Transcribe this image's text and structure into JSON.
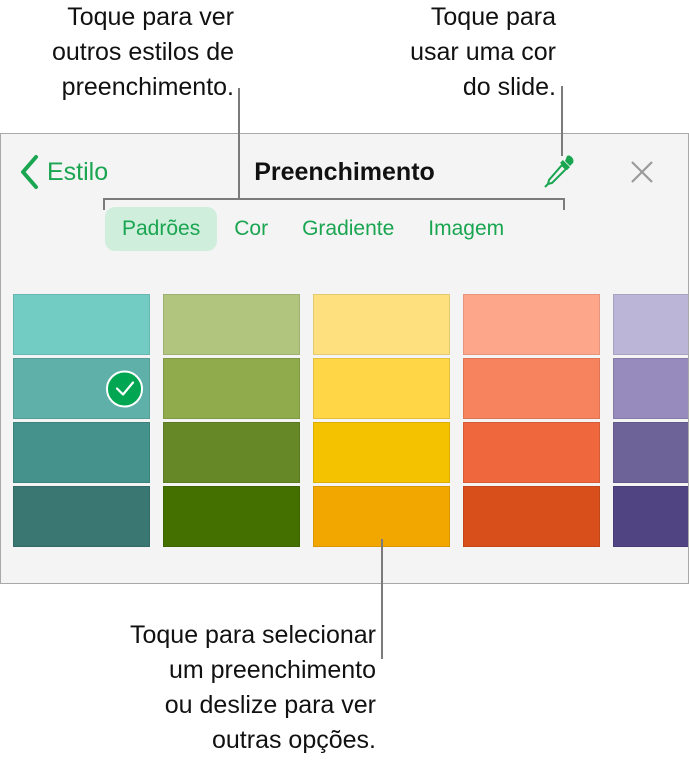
{
  "callouts": {
    "fill_styles": "Toque para ver\noutros estilos de\npreenchimento.",
    "slide_color": "Toque para\nusar uma cor\ndo slide.",
    "select_fill": "Toque para selecionar\num preenchimento\nou deslize para ver\noutras opções."
  },
  "panel": {
    "back_label": "Estilo",
    "title": "Preenchimento",
    "icons": {
      "back": "chevron-left-icon",
      "eyedropper": "eyedropper-icon",
      "close": "close-icon",
      "selected": "checkmark-icon"
    },
    "tabs": [
      {
        "label": "Padrões",
        "active": true
      },
      {
        "label": "Cor",
        "active": false
      },
      {
        "label": "Gradiente",
        "active": false
      },
      {
        "label": "Imagem",
        "active": false
      }
    ],
    "accent_color": "#1aa551",
    "swatch_columns": [
      {
        "name": "teal",
        "colors": [
          "#72ccc4",
          "#5eb0a9",
          "#45928c",
          "#3a7773"
        ]
      },
      {
        "name": "green",
        "colors": [
          "#b2c57e",
          "#8fab4b",
          "#678827",
          "#447000"
        ]
      },
      {
        "name": "yellow",
        "colors": [
          "#fee07e",
          "#fed646",
          "#f5c200",
          "#f2a700"
        ]
      },
      {
        "name": "orange",
        "colors": [
          "#fea68a",
          "#f6825e",
          "#ef673c",
          "#d84f1c"
        ]
      },
      {
        "name": "purple",
        "colors": [
          "#bbb5d7",
          "#968bbc",
          "#6e6399",
          "#504582"
        ]
      }
    ],
    "selected_swatch": {
      "column": 0,
      "row": 1
    }
  }
}
